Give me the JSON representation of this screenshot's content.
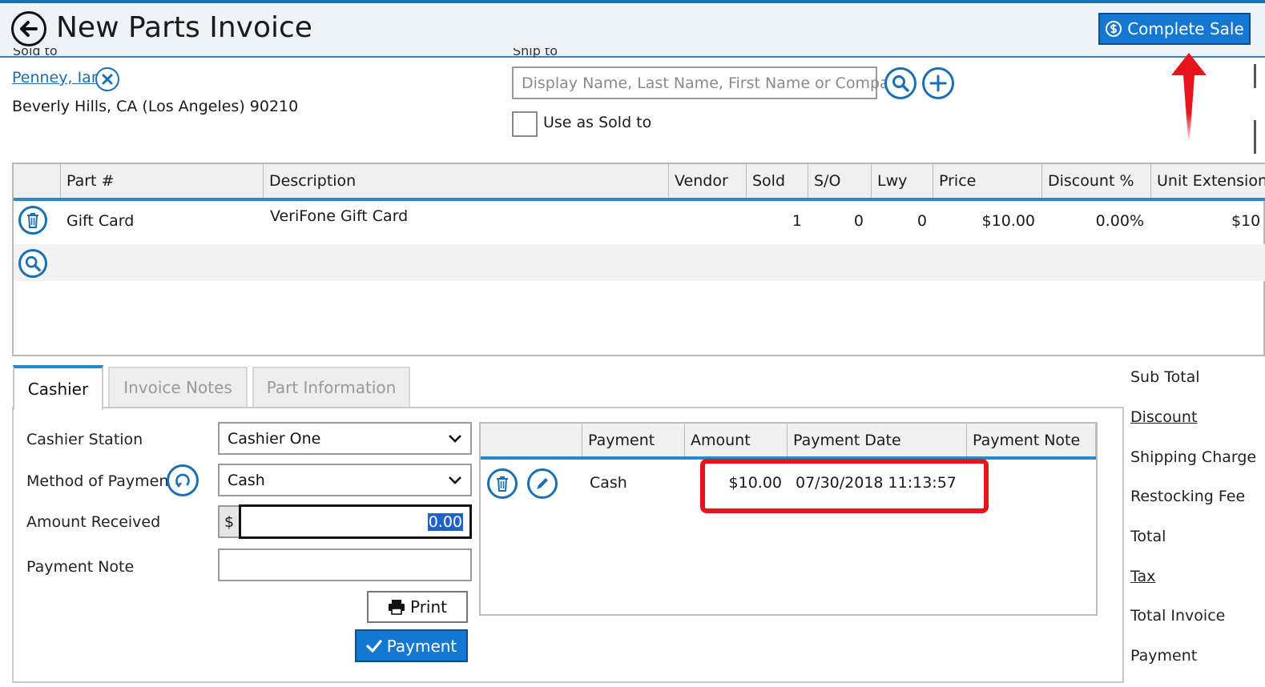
{
  "header": {
    "title": "New Parts Invoice",
    "complete_sale_label": "Complete Sale"
  },
  "sold_to": {
    "label": "Sold to",
    "customer_name": "Penney, Ian",
    "address": "Beverly Hills, CA (Los Angeles) 90210"
  },
  "ship_to": {
    "label": "Ship to",
    "search_placeholder": "Display Name, Last Name, First Name or Company",
    "use_as_sold_to_label": "Use as Sold to"
  },
  "parts_grid": {
    "columns": [
      "Part #",
      "Description",
      "Vendor",
      "Sold",
      "S/O",
      "Lwy",
      "Price",
      "Discount %",
      "Unit Extension"
    ],
    "rows": [
      {
        "part_number": "Gift Card",
        "description": "VeriFone Gift Card",
        "vendor": "",
        "sold": "1",
        "so": "0",
        "lwy": "0",
        "price": "$10.00",
        "discount": "0.00%",
        "unit_extension": "$10"
      }
    ]
  },
  "tabs": {
    "cashier": "Cashier",
    "invoice_notes": "Invoice Notes",
    "part_information": "Part Information"
  },
  "cashier": {
    "station_label": "Cashier Station",
    "station_value": "Cashier One",
    "method_label": "Method of Payment",
    "method_value": "Cash",
    "amount_label": "Amount Received",
    "currency_symbol": "$",
    "amount_value": "0.00",
    "note_label": "Payment Note",
    "note_value": "",
    "print_label": "Print",
    "payment_label": "Payment"
  },
  "payments_grid": {
    "columns": [
      "Payment",
      "Amount",
      "Payment Date",
      "Payment Note"
    ],
    "rows": [
      {
        "payment": "Cash",
        "amount": "$10.00",
        "date": "07/30/2018 11:13:57",
        "note": ""
      }
    ]
  },
  "totals": {
    "sub_total": "Sub Total",
    "discount": "Discount",
    "shipping_charge": "Shipping Charge",
    "restocking_fee": "Restocking Fee",
    "total": "Total",
    "tax": "Tax",
    "total_invoice": "Total Invoice",
    "payment": "Payment"
  },
  "colors": {
    "accent": "#1a6fb5",
    "primary_button": "#1478d2",
    "highlight_box": "#e8141b"
  }
}
